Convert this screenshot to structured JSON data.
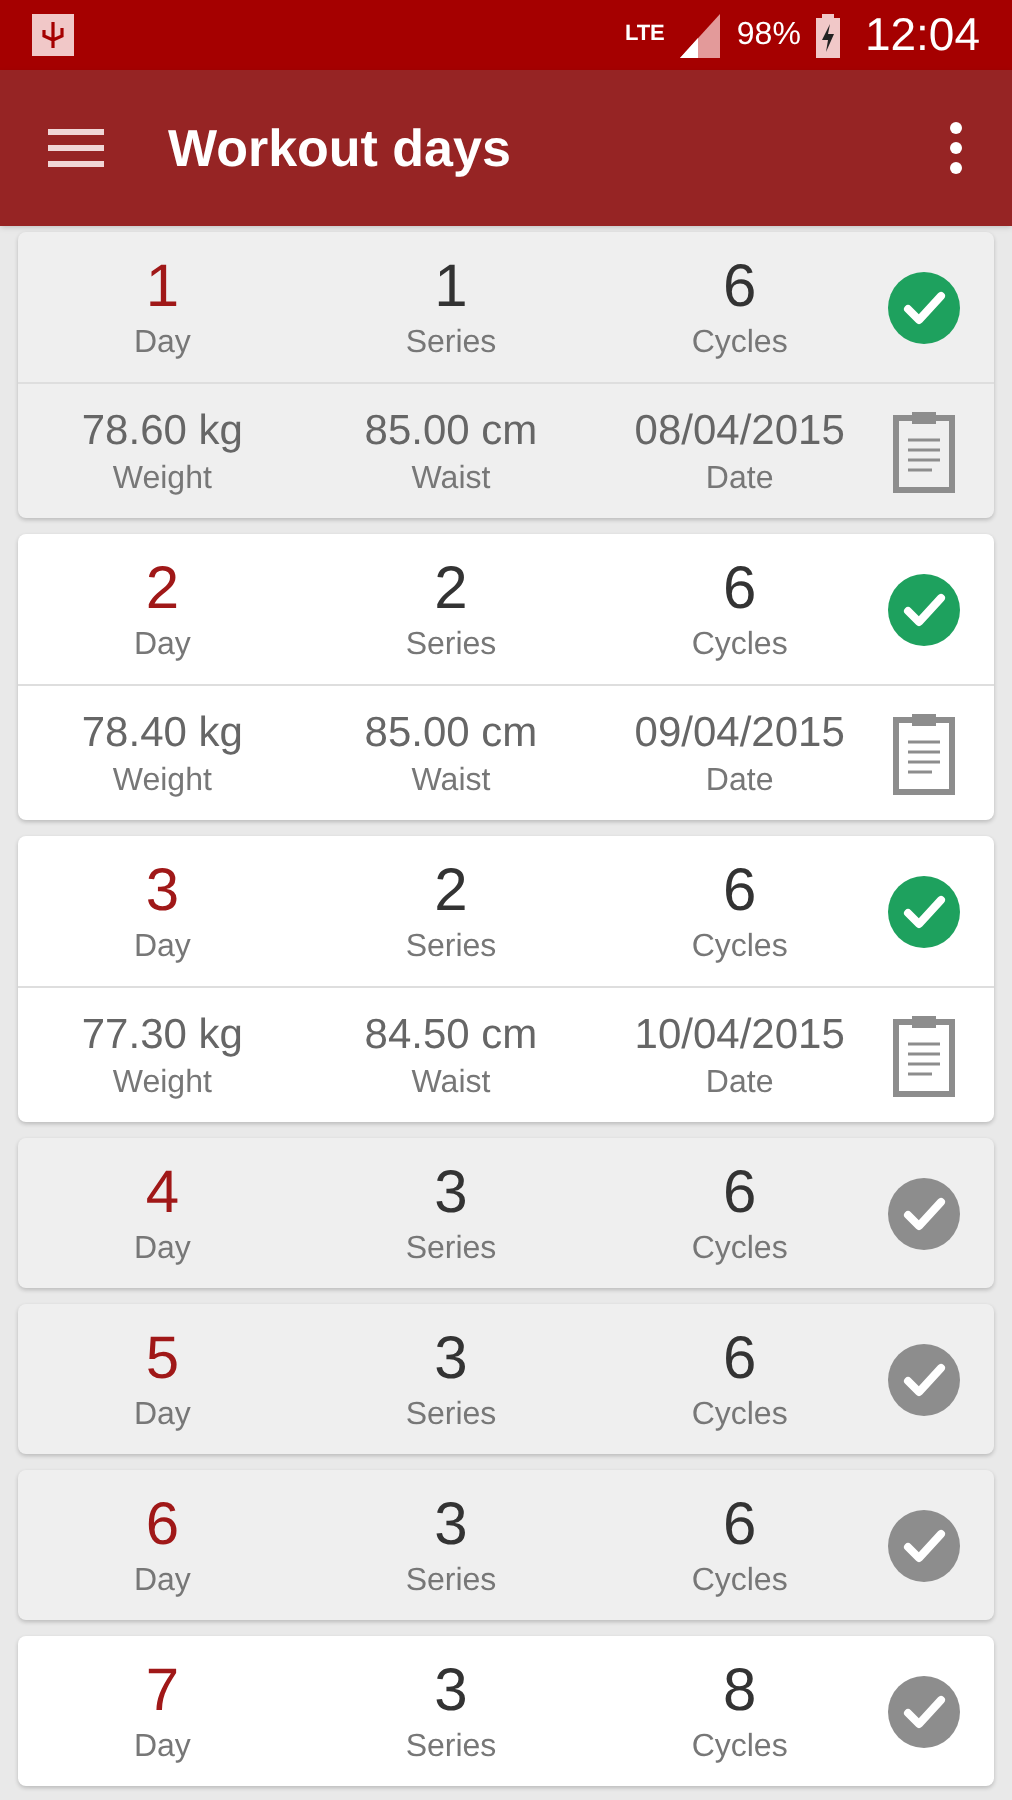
{
  "status_bar": {
    "network": "LTE",
    "battery": "98%",
    "time": "12:04"
  },
  "app_bar": {
    "title": "Workout days"
  },
  "days": [
    {
      "day": "1",
      "day_label": "Day",
      "series": "1",
      "series_label": "Series",
      "cycles": "6",
      "cycles_label": "Cycles",
      "done": true,
      "highlighted": true,
      "details": {
        "weight": "78.60 kg",
        "weight_label": "Weight",
        "waist": "85.00 cm",
        "waist_label": "Waist",
        "date": "08/04/2015",
        "date_label": "Date"
      }
    },
    {
      "day": "2",
      "day_label": "Day",
      "series": "2",
      "series_label": "Series",
      "cycles": "6",
      "cycles_label": "Cycles",
      "done": true,
      "highlighted": false,
      "details": {
        "weight": "78.40 kg",
        "weight_label": "Weight",
        "waist": "85.00 cm",
        "waist_label": "Waist",
        "date": "09/04/2015",
        "date_label": "Date"
      }
    },
    {
      "day": "3",
      "day_label": "Day",
      "series": "2",
      "series_label": "Series",
      "cycles": "6",
      "cycles_label": "Cycles",
      "done": true,
      "highlighted": false,
      "details": {
        "weight": "77.30 kg",
        "weight_label": "Weight",
        "waist": "84.50 cm",
        "waist_label": "Waist",
        "date": "10/04/2015",
        "date_label": "Date"
      }
    },
    {
      "day": "4",
      "day_label": "Day",
      "series": "3",
      "series_label": "Series",
      "cycles": "6",
      "cycles_label": "Cycles",
      "done": false,
      "highlighted": true
    },
    {
      "day": "5",
      "day_label": "Day",
      "series": "3",
      "series_label": "Series",
      "cycles": "6",
      "cycles_label": "Cycles",
      "done": false,
      "highlighted": true
    },
    {
      "day": "6",
      "day_label": "Day",
      "series": "3",
      "series_label": "Series",
      "cycles": "6",
      "cycles_label": "Cycles",
      "done": false,
      "highlighted": true
    },
    {
      "day": "7",
      "day_label": "Day",
      "series": "3",
      "series_label": "Series",
      "cycles": "8",
      "cycles_label": "Cycles",
      "done": false,
      "highlighted": false
    }
  ]
}
